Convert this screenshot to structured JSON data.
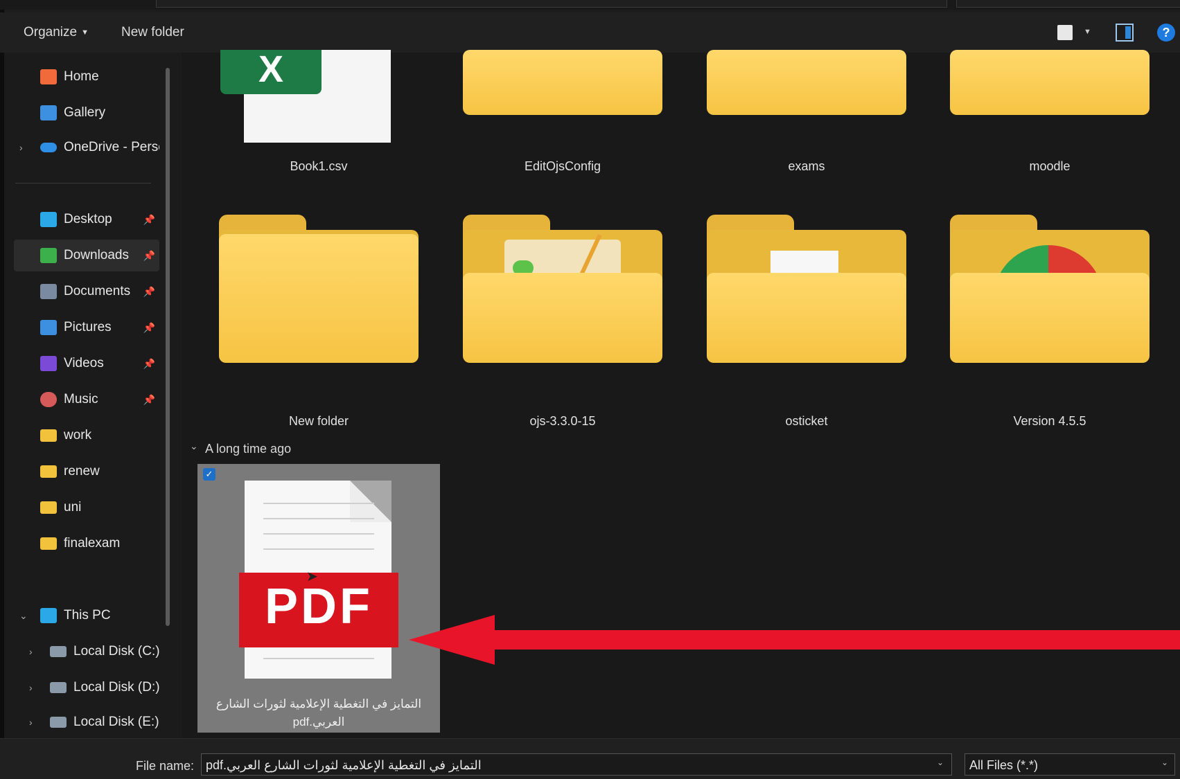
{
  "toolbar": {
    "organize_label": "Organize",
    "new_folder_label": "New folder",
    "help_glyph": "?"
  },
  "sidebar": {
    "quick_items": [
      {
        "label": "Home",
        "icon": "home-icon",
        "color": "#f06a3c"
      },
      {
        "label": "Gallery",
        "icon": "gallery-icon",
        "color": "#3d8fe0"
      },
      {
        "label": "OneDrive - Perso",
        "icon": "cloud-icon",
        "color": "#2f8ee6"
      }
    ],
    "pinned_items": [
      {
        "label": "Desktop",
        "icon": "desktop-icon",
        "color": "#2aa8e8"
      },
      {
        "label": "Downloads",
        "icon": "download-icon",
        "color": "#3cb04a"
      },
      {
        "label": "Documents",
        "icon": "documents-icon",
        "color": "#7a8aa0"
      },
      {
        "label": "Pictures",
        "icon": "pictures-icon",
        "color": "#3d8fe0"
      },
      {
        "label": "Videos",
        "icon": "videos-icon",
        "color": "#7b4ad6"
      },
      {
        "label": "Music",
        "icon": "music-icon",
        "color": "#d65a5a"
      },
      {
        "label": "work",
        "icon": "folder-icon",
        "color": "#f3c23c"
      },
      {
        "label": "renew",
        "icon": "folder-icon",
        "color": "#f3c23c"
      },
      {
        "label": "uni",
        "icon": "folder-icon",
        "color": "#f3c23c"
      },
      {
        "label": "finalexam",
        "icon": "folder-icon",
        "color": "#f3c23c"
      }
    ],
    "this_pc_label": "This PC",
    "drives": [
      {
        "label": "Local Disk (C:)"
      },
      {
        "label": "Local Disk (D:)"
      },
      {
        "label": "Local Disk (E:)"
      }
    ]
  },
  "content": {
    "row1": [
      {
        "name": "Book1.csv"
      },
      {
        "name": "EditOjsConfig"
      },
      {
        "name": "exams"
      },
      {
        "name": "moodle"
      }
    ],
    "row2": [
      {
        "name": "New folder"
      },
      {
        "name": "ojs-3.3.0-15"
      },
      {
        "name": "osticket"
      },
      {
        "name": "Version 4.5.5"
      }
    ],
    "group_label": "A long time ago",
    "selected_file": {
      "name": "التمايز في التغطية الإعلامية لثورات الشارع العربي.pdf",
      "badge": "PDF"
    }
  },
  "bottom": {
    "file_name_label": "File name:",
    "file_name_value": "التمايز في التغطية الإعلامية لثورات الشارع العربي.pdf",
    "file_type_value": "All Files (*.*)"
  },
  "colors": {
    "accent": "#1e7be0",
    "arrow": "#e8142a",
    "pdf_red": "#d8141f",
    "folder": "#f6c443"
  }
}
